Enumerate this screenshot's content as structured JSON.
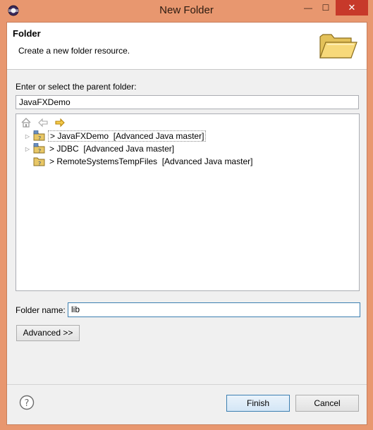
{
  "window": {
    "title": "New Folder",
    "minimize_glyph": "—",
    "maximize_glyph": "☐",
    "close_glyph": "✕"
  },
  "header": {
    "title": "Folder",
    "description": "Create a new folder resource.",
    "icon": "folder-open-icon"
  },
  "parent": {
    "label": "Enter or select the parent folder:",
    "value": "JavaFXDemo"
  },
  "tree_toolbar": {
    "home_icon": "home-icon",
    "back_icon": "back-arrow-icon",
    "forward_icon": "forward-arrow-icon"
  },
  "tree": {
    "items": [
      {
        "label": "> JavaFXDemo  [Advanced Java master]",
        "expandable": true,
        "selected": true
      },
      {
        "label": "> JDBC  [Advanced Java master]",
        "expandable": true,
        "selected": false
      },
      {
        "label": "> RemoteSystemsTempFiles  [Advanced Java master]",
        "expandable": false,
        "selected": false
      }
    ]
  },
  "folder_name": {
    "label": "Folder name:",
    "value": "lib"
  },
  "buttons": {
    "advanced": "Advanced >>",
    "finish": "Finish",
    "cancel": "Cancel",
    "help_icon": "help-icon"
  },
  "colors": {
    "title_bar": "#e8976f",
    "close_button": "#c7392a",
    "default_button_border": "#3c7fb1"
  }
}
